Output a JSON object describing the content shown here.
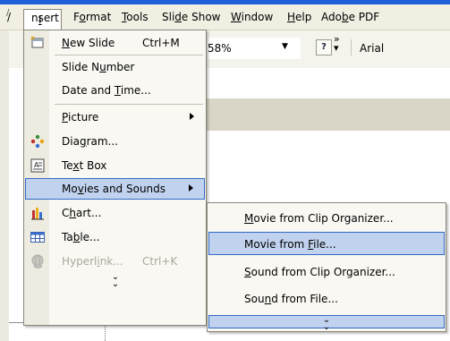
{
  "menubar": {
    "items": [
      {
        "label": "Insert",
        "key": "I"
      },
      {
        "label": "Format",
        "key": "o"
      },
      {
        "label": "Tools",
        "key": "T"
      },
      {
        "label": "Slide Show",
        "key": "d"
      },
      {
        "label": "Window",
        "key": "W"
      },
      {
        "label": "Help",
        "key": "H"
      },
      {
        "label": "Adobe PDF",
        "key": "b"
      }
    ]
  },
  "toolbar": {
    "zoom": "58%",
    "font": "Arial",
    "help_glyph": "?",
    "more_glyph": "»"
  },
  "insert_menu": {
    "items": [
      {
        "label": "New Slide",
        "key": "N",
        "shortcut": "Ctrl+M",
        "icon": "new-slide-icon"
      },
      {
        "label": "Slide Number",
        "key": "u"
      },
      {
        "label": "Date and Time...",
        "key": "T"
      },
      {
        "label": "Picture",
        "key": "P",
        "submenu": true
      },
      {
        "label": "Diagram...",
        "key": "g",
        "icon": "diagram-icon"
      },
      {
        "label": "Text Box",
        "key": "x",
        "icon": "text-box-icon"
      },
      {
        "label": "Movies and Sounds",
        "key": "v",
        "submenu": true,
        "highlighted": true
      },
      {
        "label": "Chart...",
        "key": "h",
        "icon": "chart-icon"
      },
      {
        "label": "Table...",
        "key": "b",
        "icon": "table-icon"
      },
      {
        "label": "Hyperlink...",
        "key": "i",
        "shortcut": "Ctrl+K",
        "disabled": true,
        "icon": "hyperlink-icon"
      }
    ],
    "expand_glyph": "⌄⌄"
  },
  "movies_submenu": {
    "items": [
      {
        "label": "Movie from Clip Organizer...",
        "key": "M"
      },
      {
        "label": "Movie from File...",
        "key": "F",
        "highlighted": true
      },
      {
        "label": "Sound from Clip Organizer...",
        "key": "S"
      },
      {
        "label": "Sound from File...",
        "key": "n"
      }
    ],
    "expand_glyph": "⌄⌄"
  },
  "colors": {
    "highlight": "#c1d2ee",
    "highlight_border": "#316ac5",
    "menubar": "#f1efe2",
    "disabled_text": "#a9a79b"
  }
}
